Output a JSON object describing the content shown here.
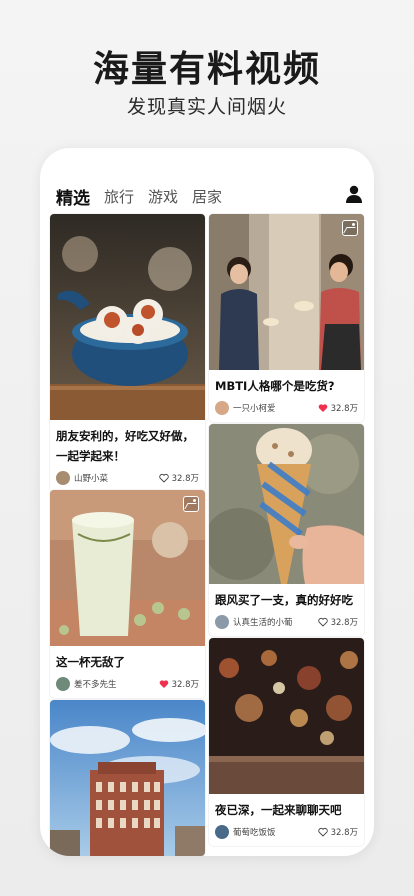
{
  "hero": {
    "title": "海量有料视频",
    "subtitle": "发现真实人间烟火"
  },
  "tabs": [
    {
      "label": "精选",
      "active": true
    },
    {
      "label": "旅行",
      "active": false
    },
    {
      "label": "游戏",
      "active": false
    },
    {
      "label": "居家",
      "active": false
    }
  ],
  "cards": [
    {
      "title": "朋友安利的，好吃又好做，一起学起来！",
      "author": "山野小菜",
      "likes": "32.8万",
      "liked": false
    },
    {
      "title": "MBTI人格哪个是吃货?",
      "author": "一只小柯爱",
      "likes": "32.8万",
      "liked": true
    },
    {
      "title": "这一杯无敌了",
      "author": "差不多先生",
      "likes": "32.8万",
      "liked": true
    },
    {
      "title": "跟风买了一支，真的好好吃",
      "author": "认真生活的小葡",
      "likes": "32.8万",
      "liked": false
    },
    {
      "title": "夜已深，一起来聊聊天吧",
      "author": "葡萄吃饭饭",
      "likes": "32.8万",
      "liked": false
    }
  ],
  "colors": {
    "accent": "#3ee08a",
    "heart_liked": "#f0304d"
  }
}
